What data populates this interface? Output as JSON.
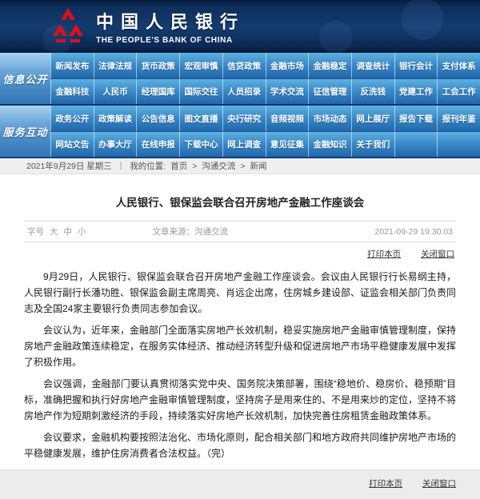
{
  "header": {
    "bank_name_cn": "中国人民银行",
    "bank_name_en": "THE PEOPLE'S BANK OF CHINA",
    "bg_color": "#0d2f5d",
    "logo_color": "#d8121c"
  },
  "nav": {
    "blocks": [
      {
        "tab": "信息公开",
        "rows": [
          {
            "items": [
              "新闻发布",
              "法律法规",
              "货币政策",
              "宏观审慎",
              "信贷政策",
              "金融市场",
              "金融稳定",
              "调查统计",
              "银行会计",
              "支付体系"
            ]
          },
          {
            "items": [
              "金融科技",
              "人民币",
              "经理国库",
              "国际交往",
              "人员招录",
              "学术交流",
              "征信管理",
              "反洗钱",
              "党建工作",
              "工会工作"
            ]
          }
        ]
      },
      {
        "tab": "服务互动",
        "rows": [
          {
            "items": [
              "政务公开",
              "政策解读",
              "公告信息",
              "图文直播",
              "央行研究",
              "音频视频",
              "市场动态",
              "网上展厅",
              "报告下载",
              "报刊年鉴"
            ]
          },
          {
            "items": [
              "网站文告",
              "办事大厅",
              "在线申报",
              "下载中心",
              "网上调查",
              "意见征集",
              "金融知识",
              "关于我们"
            ]
          }
        ]
      }
    ]
  },
  "breadcrumb": {
    "date": "2021年9月29日 星期三",
    "separator": "｜",
    "location_label": "我的位置:",
    "home": "首页",
    "arrow": ">",
    "crumbs": [
      "沟通交流",
      "新闻"
    ]
  },
  "article": {
    "title": "人民银行、银保监会联合召开房地产金融工作座谈会",
    "meta": {
      "font_size_label": "字号",
      "sizes": [
        "大",
        "中",
        "小"
      ],
      "source": "文章来源：沟通交流",
      "datetime": "2021-09-29 19:30:03"
    },
    "actions": {
      "print": "打印本页",
      "close": "关闭窗口"
    },
    "paragraphs": [
      "9月29日，人民银行、银保监会联合召开房地产金融工作座谈会。会议由人民银行行长易纲主持，人民银行副行长潘功胜、银保监会副主席周亮、肖远企出席，住房城乡建设部、证监会相关部门负责同志及全国24家主要银行负责同志参加会议。",
      "会议认为，近年来，金融部门全面落实房地产长效机制，稳妥实施房地产金融审慎管理制度，保持房地产金融政策连续稳定，在服务实体经济、推动经济转型升级和促进房地产市场平稳健康发展中发挥了积极作用。",
      "会议强调，金融部门要认真贯彻落实党中央、国务院决策部署，围绕“稳地价、稳房价、稳预期”目标，准确把握和执行好房地产金融审慎管理制度，坚持房子是用来住的、不是用来炒的定位，坚持不将房地产作为短期刺激经济的手段，持续落实好房地产长效机制，加快完善住房租赁金融政策体系。",
      "会议要求，金融机构要按照法治化、市场化原则，配合相关部门和地方政府共同维护房地产市场的平稳健康发展，维护住房消费者合法权益。（完）"
    ]
  }
}
